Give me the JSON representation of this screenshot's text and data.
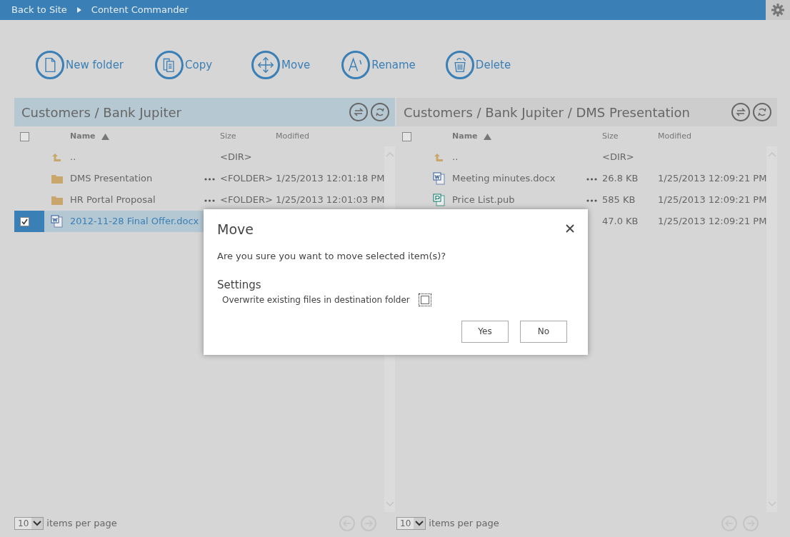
{
  "topbar": {
    "back_link": "Back to Site",
    "title": "Content Commander"
  },
  "toolbar": [
    {
      "kind": "newfolder",
      "label": "New folder"
    },
    {
      "kind": "copy",
      "label": "Copy"
    },
    {
      "kind": "move",
      "label": "Move"
    },
    {
      "kind": "rename",
      "label": "Rename"
    },
    {
      "kind": "delete",
      "label": "Delete"
    }
  ],
  "panels": [
    {
      "path": "Customers / Bank Jupiter",
      "active": true,
      "all_checked": false,
      "columns": {
        "name": "Name",
        "size": "Size",
        "modified": "Modified"
      },
      "rows": [
        {
          "kind": "up",
          "name": "..",
          "size": "<DIR>",
          "selected": false,
          "checked": false,
          "has_menu": false
        },
        {
          "kind": "folder",
          "name": "DMS Presentation",
          "size": "<FOLDER>",
          "modified": "1/25/2013 12:01:18 PM",
          "selected": false,
          "checked": false,
          "has_menu": true
        },
        {
          "kind": "folder",
          "name": "HR Portal Proposal",
          "size": "<FOLDER>",
          "modified": "1/25/2013 12:01:03 PM",
          "selected": false,
          "checked": false,
          "has_menu": true
        },
        {
          "kind": "word",
          "name": "2012-11-28 Final Offer.docx",
          "selected": true,
          "checked": true,
          "has_menu": false
        }
      ],
      "page_size": "10",
      "page_size_label": "items per page"
    },
    {
      "path": "Customers / Bank Jupiter / DMS Presentation",
      "active": false,
      "all_checked": false,
      "columns": {
        "name": "Name",
        "size": "Size",
        "modified": "Modified"
      },
      "rows": [
        {
          "kind": "up",
          "name": "..",
          "size": "<DIR>",
          "selected": false,
          "checked": false,
          "has_menu": false
        },
        {
          "kind": "word",
          "name": "Meeting minutes.docx",
          "size": "26.8 KB",
          "modified": "1/25/2013 12:09:21 PM",
          "selected": false,
          "checked": false,
          "has_menu": true
        },
        {
          "kind": "publisher",
          "name": "Price List.pub",
          "size": "585 KB",
          "modified": "1/25/2013 12:09:21 PM",
          "selected": false,
          "checked": false,
          "has_menu": true
        },
        {
          "size": "47.0 KB",
          "modified": "1/25/2013 12:09:21 PM",
          "selected": false,
          "checked": false,
          "has_menu": false
        }
      ],
      "page_size": "10",
      "page_size_label": "items per page"
    }
  ],
  "dialog": {
    "title": "Move",
    "message": "Are you sure you want to move selected item(s)?",
    "section": "Settings",
    "option": {
      "label": "Overwrite existing files in destination folder",
      "checked": false
    },
    "buttons": [
      "Yes",
      "No"
    ]
  }
}
